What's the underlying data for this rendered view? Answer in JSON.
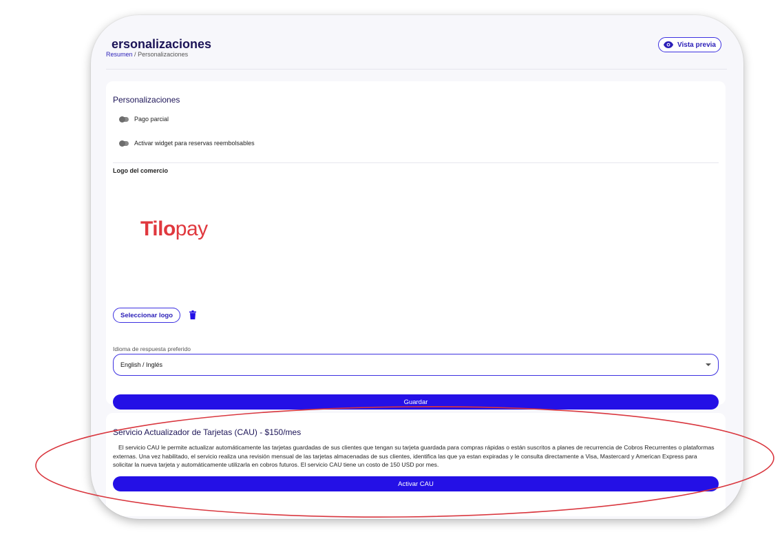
{
  "header": {
    "title": "ersonalizaciones",
    "breadcrumb": {
      "link": "Resumen",
      "separator": "/",
      "current": "Personalizaciones"
    },
    "preview_button": "Vista previa"
  },
  "personalizations": {
    "title": "Personalizaciones",
    "toggles": [
      {
        "label": "Pago parcial",
        "enabled": false
      },
      {
        "label": "Activar widget para reservas reembolsables",
        "enabled": false
      }
    ],
    "logo_label": "Logo del comercio",
    "logo": {
      "text_bold": "Tilo",
      "text_light": "pay",
      "color": "#e0383e"
    },
    "select_logo_button": "Seleccionar logo",
    "language": {
      "label": "Idioma de respuesta preferido",
      "value": "English / Inglés"
    },
    "save_button": "Guardar"
  },
  "cau": {
    "title": "Servicio Actualizador de Tarjetas (CAU) - $150/mes",
    "description": "El servicio CAU le permite actualizar automáticamente las tarjetas guardadas de sus clientes que tengan su tarjeta guardada para compras rápidas o están suscritos a planes de recurrencia de Cobros Recurrentes o plataformas externas. Una vez habilitado, el servicio realiza una revisión mensual de las tarjetas almacenadas de sus clientes, identifica las que ya estan expiradas y le consulta directamente a Visa, Mastercard y American Express para solicitar la nueva tarjeta y automáticamente utilizarla en cobros futuros. El servicio CAU tiene un costo de 150 USD por mes.",
    "activate_button": "Activar CAU"
  },
  "colors": {
    "primary": "#2410e6",
    "title_text": "#1c1457",
    "annotation": "#d9363e"
  }
}
